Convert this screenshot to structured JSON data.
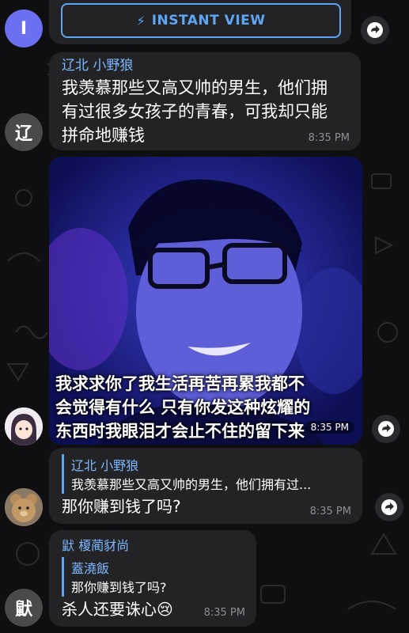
{
  "instant_view": {
    "label": "INSTANT VIEW"
  },
  "avatars": {
    "first": "I",
    "second": "辽",
    "last": "鼣"
  },
  "msg1": {
    "sender": "辽北 小野狼",
    "text_lines": [
      "我羡慕那些又高又帅的男生，他们拥",
      "有过很多女孩子的青春，可我却只能",
      "拼命地赚钱"
    ],
    "time": "8:35 PM"
  },
  "photo_msg": {
    "caption_lines": [
      "我求求你了我生活再苦再累我都不",
      "会觉得有什么 只有你发这种炫耀的",
      "东西时我眼泪才会止不住的留下来"
    ],
    "time": "8:35 PM"
  },
  "msg2": {
    "reply_sender": "辽北 小野狼",
    "reply_text": "我羡慕那些又高又帅的男生，他们拥有过...",
    "text": "那你赚到钱了吗?",
    "time": "8:35 PM"
  },
  "msg3": {
    "sender": "鼣 榎蔺豺尚",
    "reply_sender": "蓋澆飯",
    "reply_text": "那你赚到钱了吗?",
    "text": "杀人还要诛心",
    "emoji": "😢",
    "time": "8:35 PM"
  },
  "colors": {
    "background": "#0f0f12",
    "bubble": "#232326",
    "accent": "#7cb8ff",
    "time": "#8d8d94"
  }
}
